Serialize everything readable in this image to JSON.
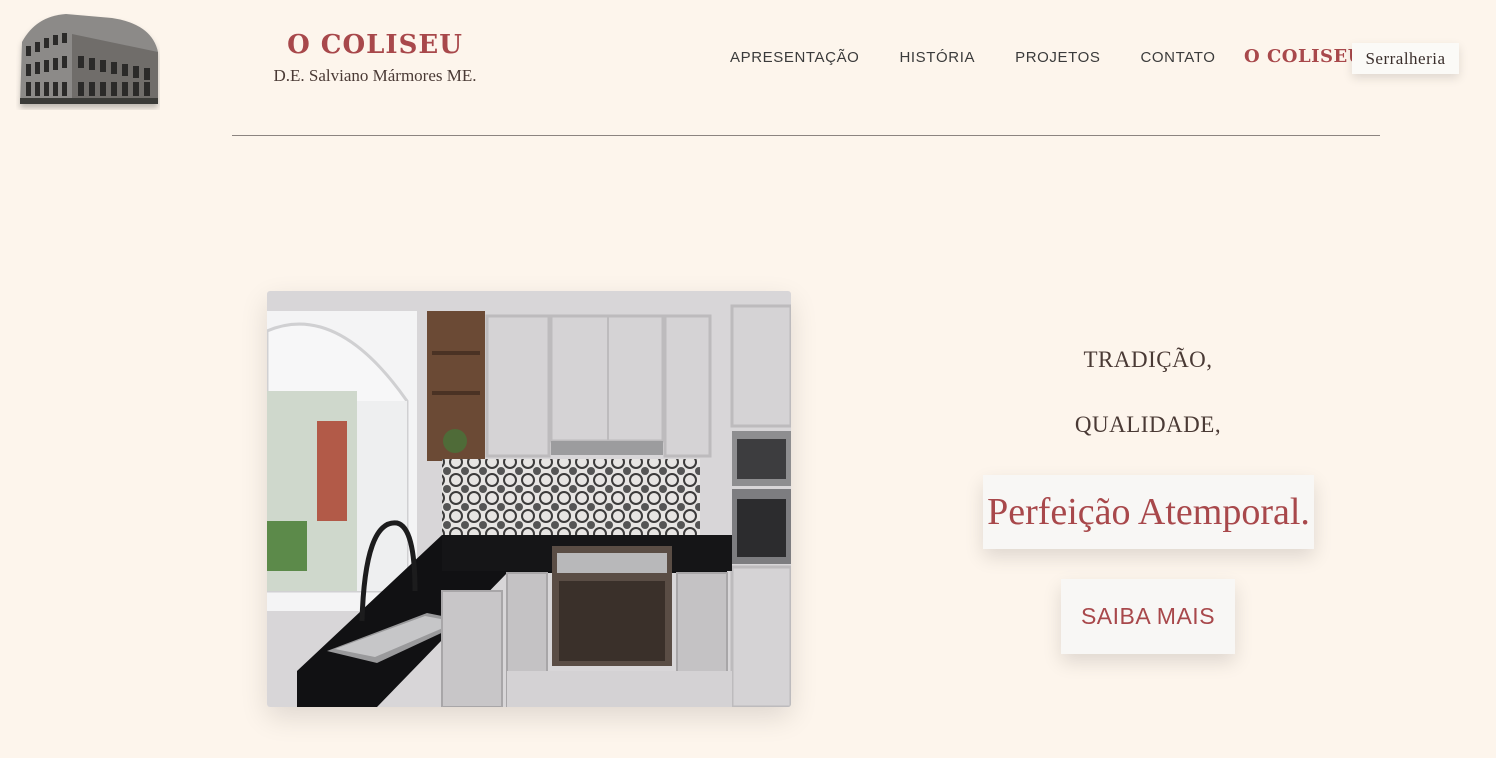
{
  "header": {
    "logo_icon": "colosseum-logo",
    "brand_title": "O COLISEU",
    "brand_subtitle": "D.E. Salviano Mármores ME."
  },
  "nav": {
    "links": [
      "APRESENTAÇÃO",
      "HISTÓRIA",
      "PROJETOS",
      "CONTATO"
    ],
    "brand_link": "O COLISEU",
    "pill_link": "Serralheria"
  },
  "hero": {
    "image_icon": "kitchen-photo",
    "line1": "TRADIÇÃO,",
    "line2": "QUALIDADE,",
    "highlight": "Perfeição Atemporal.",
    "cta": "SAIBA MAIS"
  },
  "colors": {
    "background": "#fdf5ec",
    "accent": "#a8484b",
    "text": "#3b3b3b"
  }
}
